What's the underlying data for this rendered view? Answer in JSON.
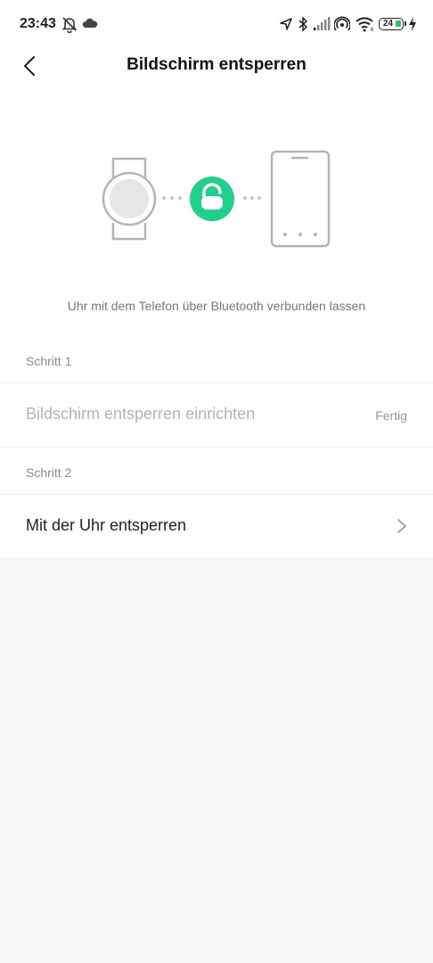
{
  "status_bar": {
    "time": "23:43",
    "battery": "24",
    "icons": [
      "alarm-off-icon",
      "cloud-icon",
      "location-icon",
      "bluetooth-icon",
      "signal-icon",
      "hotspot-icon",
      "wifi-icon",
      "battery-icon",
      "charging-icon"
    ]
  },
  "header": {
    "title": "Bildschirm entsperren",
    "back_icon": "chevron-left-icon"
  },
  "illustration": {
    "accent_color": "#1ed18a",
    "icons": [
      "watch-icon",
      "unlock-icon",
      "phone-icon"
    ]
  },
  "caption": "Uhr mit dem Telefon über Bluetooth verbunden lassen",
  "steps": [
    {
      "section": "Schritt 1",
      "label": "Bildschirm entsperren einrichten",
      "status": "Fertig",
      "enabled": false
    },
    {
      "section": "Schritt 2",
      "label": "Mit der Uhr entsperren",
      "enabled": true,
      "icon": "chevron-right-icon"
    }
  ]
}
